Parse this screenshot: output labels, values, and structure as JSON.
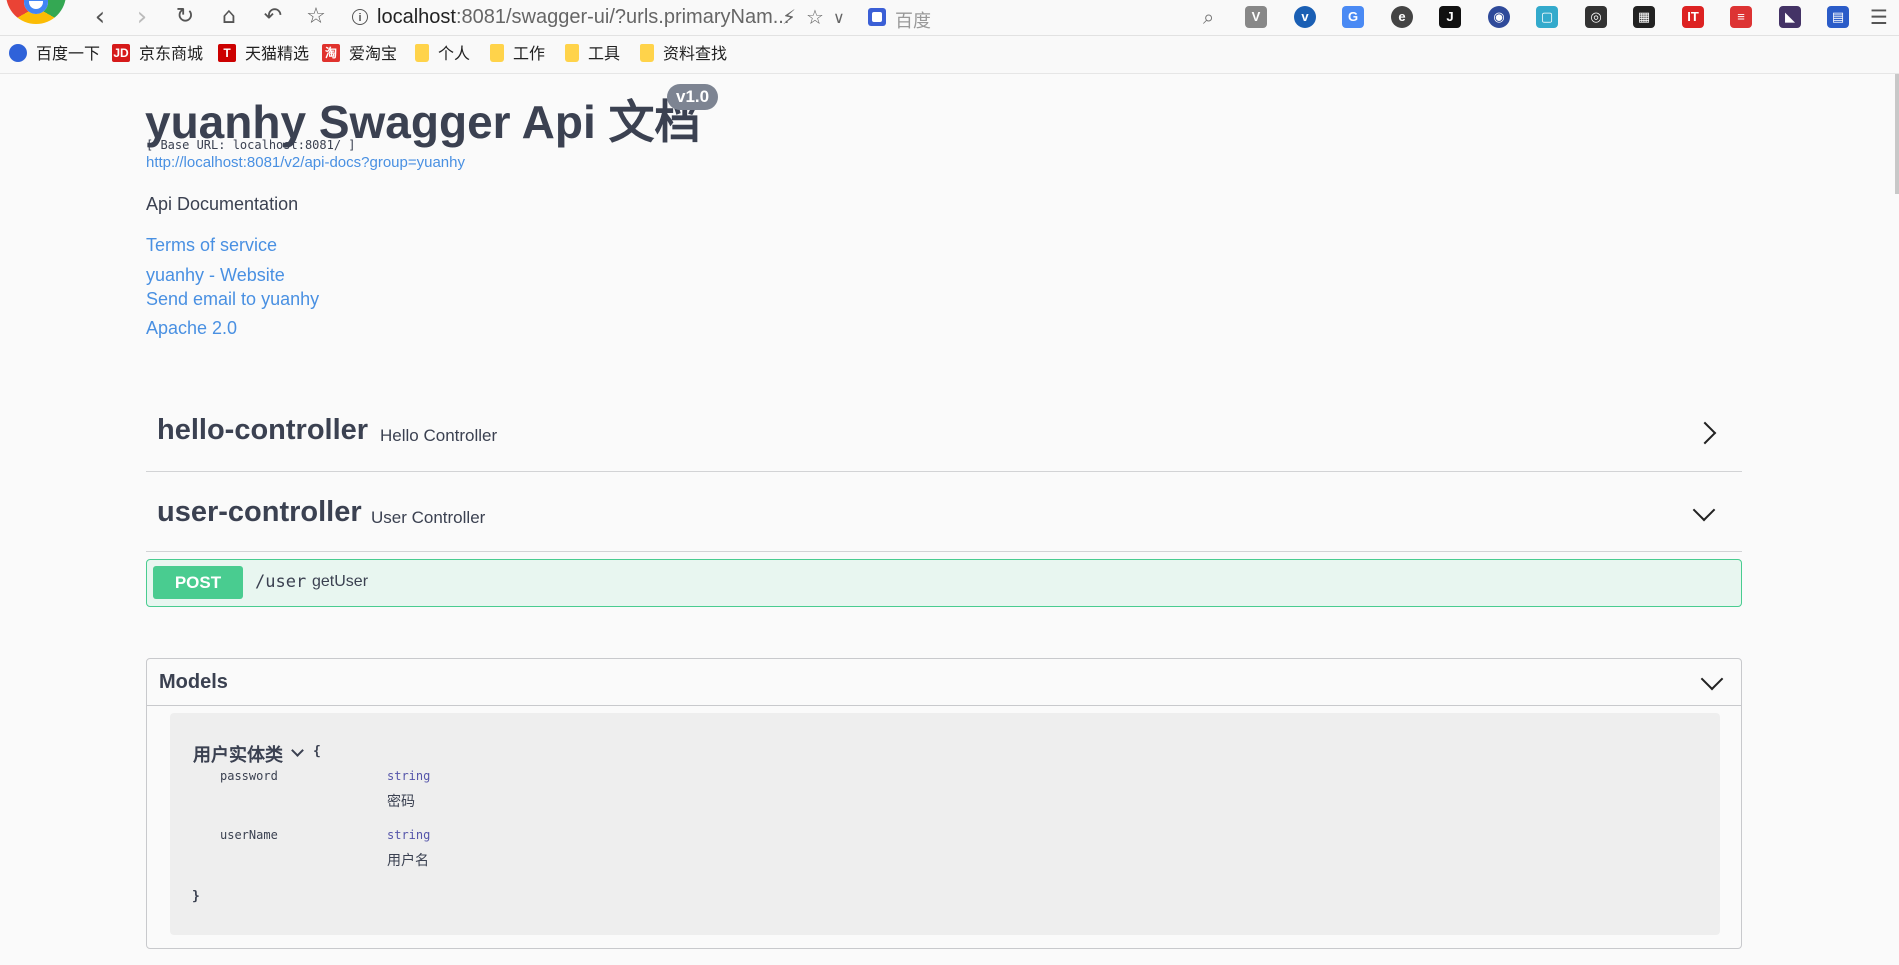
{
  "browser": {
    "address_host": "localhost",
    "address_rest": ":8081/swagger-ui/?urls.primaryNam...",
    "search_placeholder": "百度",
    "bookmarks": [
      "百度一下",
      "京东商城",
      "天猫精选",
      "爱淘宝",
      "个人",
      "工作",
      "工具",
      "资料查找"
    ]
  },
  "info": {
    "title": "yuanhy Swagger Api 文档",
    "version": "v1.0",
    "base_url": "[ Base URL: localhost:8081/ ]",
    "api_docs_url": "http://localhost:8081/v2/api-docs?group=yuanhy",
    "description": "Api Documentation",
    "terms": "Terms of service",
    "website": "yuanhy - Website",
    "email": "Send email to yuanhy",
    "license": "Apache 2.0"
  },
  "tags": [
    {
      "name": "hello-controller",
      "description": "Hello Controller",
      "expanded": false
    },
    {
      "name": "user-controller",
      "description": "User Controller",
      "expanded": true
    }
  ],
  "operation": {
    "method": "POST",
    "path": "/user",
    "summary": "getUser",
    "color": "#49cc90"
  },
  "models": {
    "title": "Models",
    "model_name": "用户实体类",
    "open_brace": "{",
    "close_brace": "}",
    "properties": [
      {
        "name": "password",
        "type": "string",
        "description": "密码"
      },
      {
        "name": "userName",
        "type": "string",
        "description": "用户名"
      }
    ]
  }
}
